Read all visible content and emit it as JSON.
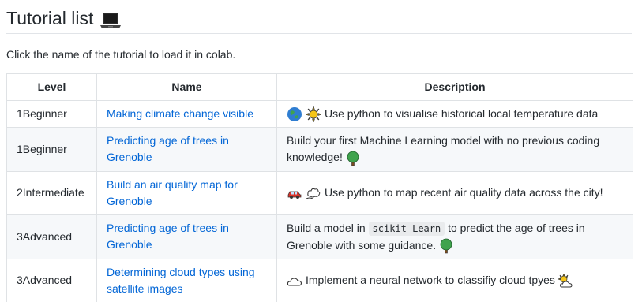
{
  "heading": {
    "title": "Tutorial list",
    "icon": "laptop-icon"
  },
  "intro": "Click the name of the tutorial to load it in colab.",
  "table": {
    "headers": [
      "Level",
      "Name",
      "Description"
    ],
    "rows": [
      {
        "level": "1Beginner",
        "name": "Making climate change visible",
        "description": "Use python to visualise historical local temperature data",
        "icons": [
          "globe-icon",
          "sun-icon"
        ]
      },
      {
        "level": "1Beginner",
        "name": "Predicting age of trees in Grenoble",
        "description": "Build your first Machine Learning model with no previous coding knowledge!",
        "icons": [
          "tree-icon"
        ]
      },
      {
        "level": "2Intermediate",
        "name": "Build an air quality map for Grenoble",
        "description": "Use python to map recent air quality data across the city!",
        "icons": [
          "car-icon",
          "smoke-icon"
        ]
      },
      {
        "level": "3Advanced",
        "name": "Predicting age of trees in Grenoble",
        "description_before": "Build a model in",
        "description_code": "scikit-Learn",
        "description_after": "to predict the age of trees in Grenoble with some guidance.",
        "icons": [
          "tree-icon"
        ]
      },
      {
        "level": "3Advanced",
        "name": "Determining cloud types using satellite images",
        "description": "Implement a neural network to classifiy cloud tpyes",
        "icons": [
          "cloud-icon",
          "sun-behind-cloud-icon"
        ]
      }
    ]
  },
  "colors": {
    "link": "#0366d6",
    "text": "#24292e",
    "border": "#dfe2e5",
    "alt_row": "#f6f8fa"
  }
}
